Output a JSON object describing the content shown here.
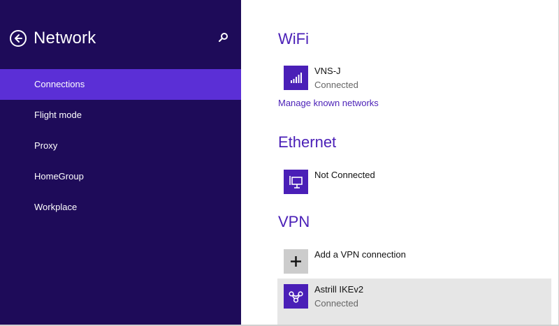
{
  "sidebar": {
    "title": "Network",
    "items": [
      {
        "label": "Connections",
        "active": true
      },
      {
        "label": "Flight mode",
        "active": false
      },
      {
        "label": "Proxy",
        "active": false
      },
      {
        "label": "HomeGroup",
        "active": false
      },
      {
        "label": "Workplace",
        "active": false
      }
    ]
  },
  "main": {
    "wifi": {
      "title": "WiFi",
      "network": {
        "name": "VNS-J",
        "status": "Connected",
        "icon": "wifi-signal-icon"
      },
      "manage_link": "Manage known networks"
    },
    "ethernet": {
      "title": "Ethernet",
      "adapter": {
        "name": "Not Connected",
        "icon": "ethernet-icon"
      }
    },
    "vpn": {
      "title": "VPN",
      "add": {
        "label": "Add a VPN connection",
        "icon": "plus-icon"
      },
      "connection": {
        "name": "Astrill IKEv2",
        "status": "Connected",
        "icon": "vpn-icon"
      }
    }
  },
  "colors": {
    "sidebar_bg": "#1e0b59",
    "active_item": "#5b2fd6",
    "accent": "#4a1fb7",
    "selected_row": "#e6e6e6"
  }
}
